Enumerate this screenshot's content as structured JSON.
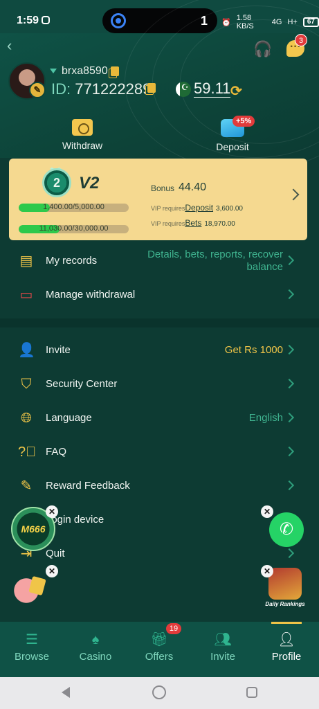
{
  "status": {
    "time": "1:59",
    "pill_number": "1",
    "net_speed": "1.58 KB/S",
    "signal": "4G",
    "signal2": "H+",
    "battery": "67"
  },
  "header": {
    "chat_badge": "3",
    "username": "brxa8590",
    "id_label": "ID:",
    "id_value": "771222289",
    "balance": "59.11"
  },
  "actions": {
    "withdraw": "Withdraw",
    "deposit": "Deposit",
    "deposit_badge": "+5%"
  },
  "vip": {
    "medal": "2",
    "level": "V2",
    "bar1_text": "1,400.00/5,000.00",
    "bar1_progress": 0.28,
    "bar2_text": "11,030.00/30,000.00",
    "bar2_progress": 0.37,
    "bonus_label": "Bonus",
    "bonus_value": "44.40",
    "req_prefix": "VIP requires",
    "deposit_link": "Deposit",
    "deposit_value": "3,600.00",
    "bets_link": "Bets",
    "bets_value": "18,970.00"
  },
  "menu_top": [
    {
      "label": "My records",
      "value_line1": "Details, bets, reports, recover",
      "value_line2": "balance"
    },
    {
      "label": "Manage withdrawal",
      "value": ""
    }
  ],
  "menu": [
    {
      "label": "Invite",
      "value": "Get Rs 1000"
    },
    {
      "label": "Security Center",
      "value": ""
    },
    {
      "label": "Language",
      "value": "English"
    },
    {
      "label": "FAQ",
      "value": ""
    },
    {
      "label": "Reward Feedback",
      "value": ""
    },
    {
      "label": "Login device",
      "value": ""
    },
    {
      "label": "Quit",
      "value": ""
    }
  ],
  "floats": {
    "m666": "M666",
    "daily_rankings": "Daily Rankings"
  },
  "nav": {
    "items": [
      {
        "label": "Browse"
      },
      {
        "label": "Casino"
      },
      {
        "label": "Offers"
      },
      {
        "label": "Invite"
      },
      {
        "label": "Profile"
      }
    ],
    "offers_badge": "19"
  }
}
